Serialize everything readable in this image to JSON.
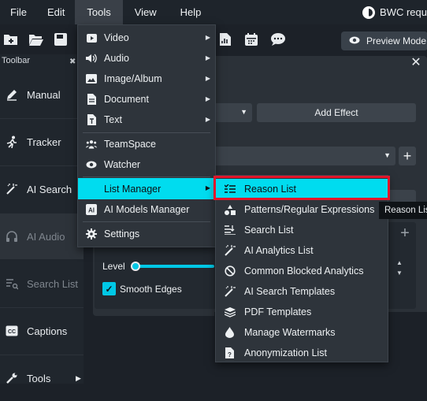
{
  "menubar": {
    "items": [
      "File",
      "Edit",
      "Tools",
      "View",
      "Help"
    ],
    "brand": "BWC requ"
  },
  "toolbar": {
    "preview_label": "Preview Mode",
    "panel_title": "Toolbar"
  },
  "sidebar": {
    "items": [
      {
        "label": "Manual",
        "icon": "pencil-icon"
      },
      {
        "label": "Tracker",
        "icon": "running-person-icon"
      },
      {
        "label": "AI Search",
        "icon": "magic-wand-icon"
      },
      {
        "label": "AI Audio",
        "icon": "headphones-icon"
      },
      {
        "label": "Search List",
        "icon": "list-search-icon"
      },
      {
        "label": "Captions",
        "icon": "closed-caption-icon"
      },
      {
        "label": "Tools",
        "icon": "wrench-icon"
      }
    ]
  },
  "dialog": {
    "add_effect_label": "Add Effect",
    "level_label": "Level",
    "level_value": 1.0,
    "smooth_edges_label": "Smooth Edges",
    "smooth_edges_checked": true,
    "close_glyph": "✕",
    "plus_glyph": "+"
  },
  "tools_menu": {
    "items": [
      {
        "label": "Video",
        "icon": "video-icon",
        "has_submenu": true
      },
      {
        "label": "Audio",
        "icon": "speaker-icon",
        "has_submenu": true
      },
      {
        "label": "Image/Album",
        "icon": "image-icon",
        "has_submenu": true
      },
      {
        "label": "Document",
        "icon": "document-icon",
        "has_submenu": true
      },
      {
        "label": "Text",
        "icon": "text-icon",
        "has_submenu": true
      },
      {
        "label": "TeamSpace",
        "icon": "team-icon",
        "has_submenu": false
      },
      {
        "label": "Watcher",
        "icon": "eye-icon",
        "has_submenu": false
      },
      {
        "label": "List Manager",
        "icon": "",
        "has_submenu": true
      },
      {
        "label": "AI Models Manager",
        "icon": "ai-icon",
        "has_submenu": false
      },
      {
        "label": "Settings",
        "icon": "gear-icon",
        "has_submenu": false
      }
    ],
    "active": "List Manager"
  },
  "list_manager_submenu": {
    "items": [
      {
        "label": "Reason List",
        "icon": "reason-list-icon"
      },
      {
        "label": "Patterns/Regular Expressions",
        "icon": "shapes-icon"
      },
      {
        "label": "Search List",
        "icon": "list-search-icon"
      },
      {
        "label": "AI Analytics List",
        "icon": "magic-wand-icon"
      },
      {
        "label": "Common Blocked Analytics",
        "icon": "blocked-icon"
      },
      {
        "label": "AI Search Templates",
        "icon": "magic-wand-icon"
      },
      {
        "label": "PDF Templates",
        "icon": "layers-icon"
      },
      {
        "label": "Manage Watermarks",
        "icon": "droplet-icon"
      },
      {
        "label": "Anonymization List",
        "icon": "file-question-icon"
      }
    ],
    "active": "Reason List"
  },
  "tooltip": "Reason List",
  "colors": {
    "accent": "#00dcef",
    "highlight_outline": "#e2162a",
    "menu_bg": "#2e343b",
    "app_bg": "#1c2128"
  }
}
